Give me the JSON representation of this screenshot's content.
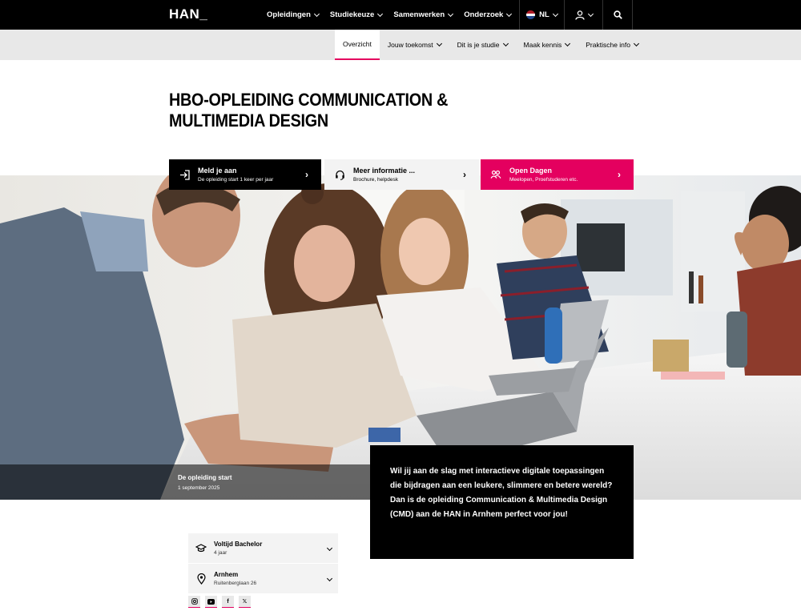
{
  "header": {
    "logo": "HAN_",
    "nav": [
      "Opleidingen",
      "Studiekeuze",
      "Samenwerken",
      "Onderzoek"
    ],
    "language": "NL"
  },
  "subnav": {
    "items": [
      "Overzicht",
      "Jouw toekomst",
      "Dit is je studie",
      "Maak kennis",
      "Praktische info"
    ],
    "active": "Overzicht"
  },
  "page": {
    "title_line1": "HBO-OPLEIDING COMMUNICATION &",
    "title_line2": "MULTIMEDIA DESIGN"
  },
  "cta": [
    {
      "title": "Meld je aan",
      "subtitle": "De opleiding start 1 keer per jaar",
      "icon": "login-icon"
    },
    {
      "title": "Meer informatie ...",
      "subtitle": "Brochure, helpdesk",
      "icon": "headset-icon"
    },
    {
      "title": "Open Dagen",
      "subtitle": "Meelopen, Proefstuderen etc.",
      "icon": "people-icon"
    }
  ],
  "hero": {
    "caption_title": "De opleiding start",
    "caption_date": "1 september 2025"
  },
  "intro": "Wil jij aan de slag met interactieve digitale toepassingen die bijdragen aan een leukere, slimmere en betere wereld? Dan is de opleiding Communication & Multimedia Design (CMD) aan de HAN in Arnhem perfect voor jou!",
  "cards": [
    {
      "title": "Voltijd Bachelor",
      "subtitle": "4 jaar",
      "icon": "graduation-cap-icon"
    },
    {
      "title": "Arnhem",
      "subtitle": "Ruitenberglaan 26",
      "icon": "location-pin-icon"
    }
  ],
  "socials": [
    "instagram-icon",
    "youtube-icon",
    "facebook-icon",
    "x-icon"
  ],
  "colors": {
    "accent": "#e4005f",
    "dark": "#000000",
    "subnav_bg": "#e8e8e8"
  }
}
